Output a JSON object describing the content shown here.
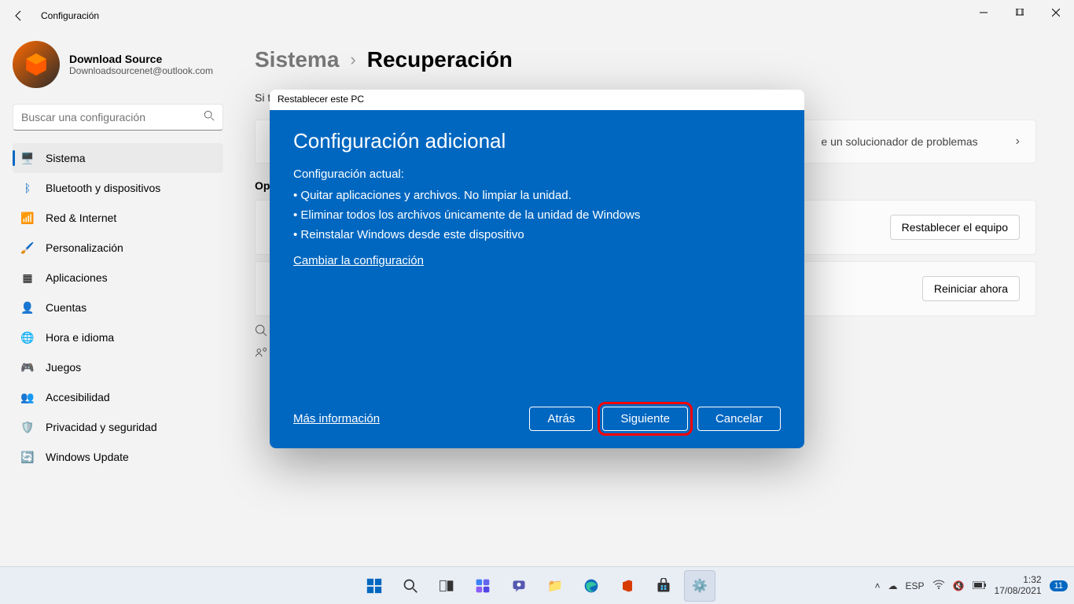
{
  "window": {
    "title": "Configuración"
  },
  "profile": {
    "name": "Download Source",
    "email": "Downloadsourcenet@outlook.com"
  },
  "search": {
    "placeholder": "Buscar una configuración"
  },
  "sidebar": {
    "items": [
      {
        "label": "Sistema",
        "icon": "display-icon",
        "active": true
      },
      {
        "label": "Bluetooth y dispositivos",
        "icon": "bluetooth-icon"
      },
      {
        "label": "Red & Internet",
        "icon": "wifi-icon"
      },
      {
        "label": "Personalización",
        "icon": "brush-icon"
      },
      {
        "label": "Aplicaciones",
        "icon": "apps-icon"
      },
      {
        "label": "Cuentas",
        "icon": "person-icon"
      },
      {
        "label": "Hora e idioma",
        "icon": "globe-icon"
      },
      {
        "label": "Juegos",
        "icon": "gamepad-icon"
      },
      {
        "label": "Accesibilidad",
        "icon": "accessibility-icon"
      },
      {
        "label": "Privacidad y seguridad",
        "icon": "shield-icon"
      },
      {
        "label": "Windows Update",
        "icon": "update-icon"
      }
    ]
  },
  "breadcrumb": {
    "parent": "Sistema",
    "current": "Recuperación"
  },
  "hint_prefix": "Si ti",
  "troubleshoot_suffix": "e un solucionador de problemas",
  "section_label": "Op",
  "buttons": {
    "reset_pc": "Restablecer el equipo",
    "restart_now": "Reiniciar ahora"
  },
  "dialog": {
    "title": "Restablecer este PC",
    "heading": "Configuración adicional",
    "current_label": "Configuración actual:",
    "items": [
      "Quitar aplicaciones y archivos. No limpiar la unidad.",
      "Eliminar todos los archivos únicamente de la unidad de Windows",
      "Reinstalar Windows desde este dispositivo"
    ],
    "change_link": "Cambiar la configuración",
    "more_info": "Más información",
    "back": "Atrás",
    "next": "Siguiente",
    "cancel": "Cancelar"
  },
  "taskbar": {
    "lang": "ESP",
    "time": "1:32",
    "date": "17/08/2021",
    "notif_count": "11"
  }
}
